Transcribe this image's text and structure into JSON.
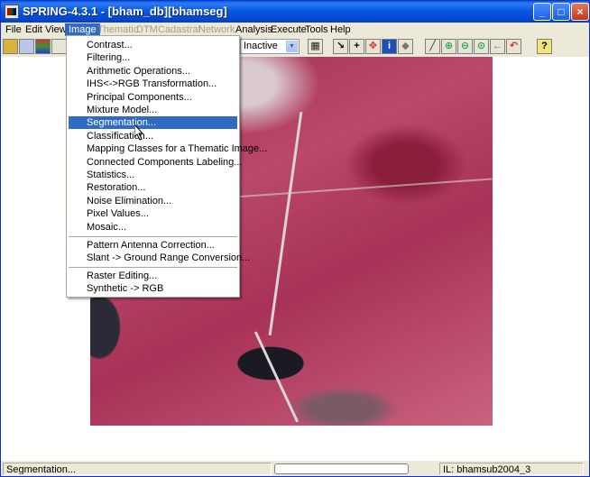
{
  "window": {
    "title": "SPRING-4.3.1 - [bham_db][bhamseg]",
    "minimize": "_",
    "maximize": "□",
    "close": "×"
  },
  "menubar": {
    "items": [
      {
        "label": "File",
        "enabled": true
      },
      {
        "label": "Edit",
        "enabled": true
      },
      {
        "label": "View",
        "enabled": true
      },
      {
        "label": "Image",
        "enabled": true,
        "active": true
      },
      {
        "label": "Thematic",
        "enabled": false
      },
      {
        "label": "DTM",
        "enabled": false
      },
      {
        "label": "Cadastral",
        "enabled": false
      },
      {
        "label": "Network",
        "enabled": false
      },
      {
        "label": "Analysis",
        "enabled": true
      },
      {
        "label": "Execute",
        "enabled": true
      },
      {
        "label": "Tools",
        "enabled": true
      },
      {
        "label": "Help",
        "enabled": true
      }
    ]
  },
  "toolbar": {
    "mode_select": "Inactive"
  },
  "image_menu": {
    "group1": [
      "Contrast...",
      "Filtering...",
      "Arithmetic Operations...",
      "IHS<->RGB Transformation...",
      "Principal Components...",
      "Mixture Model...",
      "Segmentation...",
      "Classification...",
      "Mapping Classes for a Thematic Image...",
      "Connected Components Labeling...",
      "Statistics...",
      "Restoration...",
      "Noise Elimination...",
      "Pixel Values...",
      "Mosaic..."
    ],
    "group2": [
      "Pattern Antenna Correction...",
      "Slant -> Ground Range Conversion..."
    ],
    "group3": [
      "Raster Editing...",
      "Synthetic -> RGB"
    ],
    "highlighted": "Segmentation..."
  },
  "statusbar": {
    "message": "Segmentation...",
    "info_plane": "IL: bhamsub2004_3"
  }
}
